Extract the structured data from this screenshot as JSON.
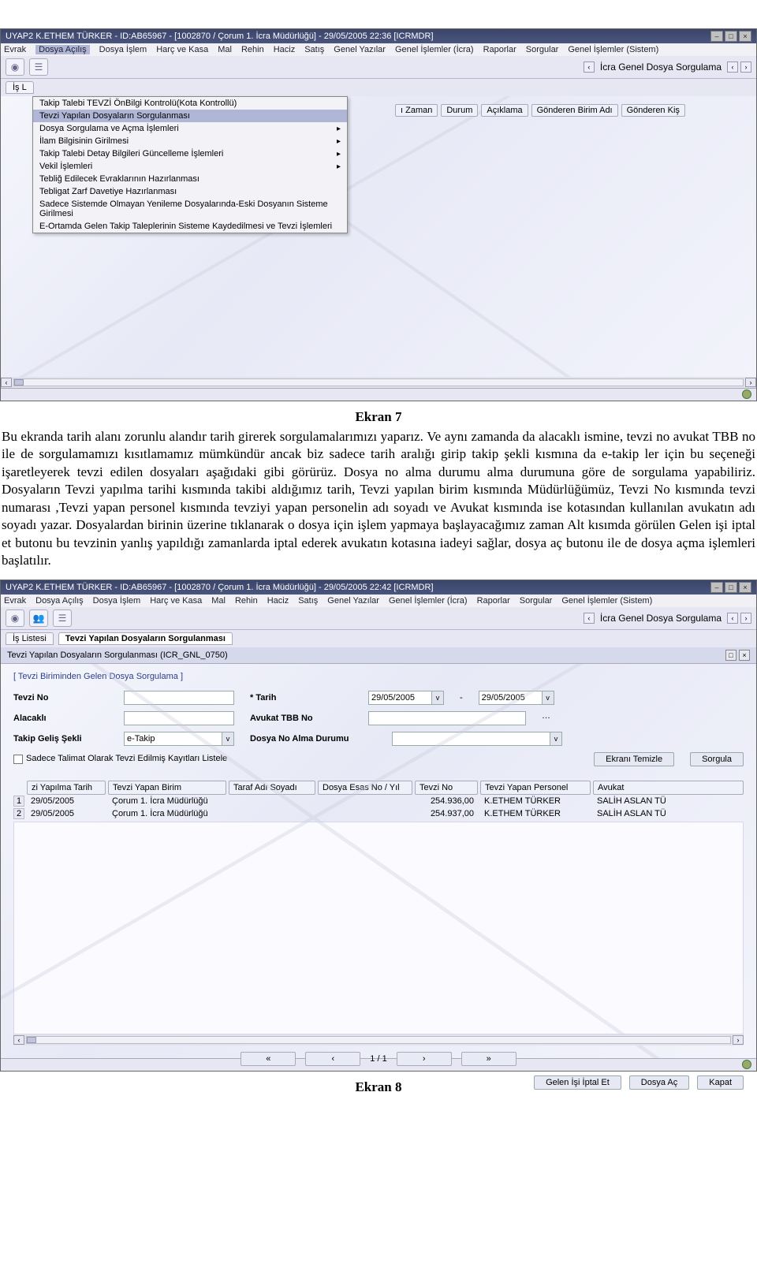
{
  "screenshot1": {
    "title": "UYAP2  K.ETHEM TÜRKER - ID:AB65967 - [1002870 / Çorum 1. İcra Müdürlüğü] - 29/05/2005 22:36 [ICRMDR]",
    "menubar": [
      "Evrak",
      "Dosya Açılış",
      "Dosya İşlem",
      "Harç ve Kasa",
      "Mal",
      "Rehin",
      "Haciz",
      "Satış",
      "Genel Yazılar",
      "Genel İşlemler (İcra)",
      "Raporlar",
      "Sorgular",
      "Genel İşlemler (Sistem)"
    ],
    "menu_active_index": 1,
    "breadcrumb_right": "İcra Genel Dosya Sorgulama",
    "tab_left": "İş L",
    "dropdown": [
      "Takip Talebi TEVZİ ÖnBilgi Kontrolü(Kota Kontrollü)",
      "Tevzi Yapılan Dosyaların Sorgulanması",
      "Dosya Sorgulama ve Açma İşlemleri",
      "İlam Bilgisinin Girilmesi",
      "Takip Talebi Detay Bilgileri Güncelleme İşlemleri",
      "Vekil İşlemleri",
      "Tebliğ Edilecek Evraklarının Hazırlanması",
      "Tebligat Zarf Davetiye Hazırlanması",
      "Sadece Sistemde Olmayan Yenileme Dosyalarında-Eski Dosyanın Sisteme Girilmesi",
      "E-Ortamda Gelen Takip Taleplerinin Sisteme Kaydedilmesi ve Tevzi İşlemleri"
    ],
    "dropdown_hl_index": 1,
    "dropdown_arrow_indices": [
      2,
      3,
      4,
      5
    ],
    "column_headers_partial": [
      "ı Zaman",
      "Durum",
      "Açıklama",
      "Gönderen Birim Adı",
      "Gönderen Kiş"
    ]
  },
  "caption1": "Ekran 7",
  "paragraph1": "Bu ekranda tarih alanı zorunlu alandır tarih girerek sorgulamalarımızı yaparız. Ve aynı zamanda da alacaklı ismine, tevzi no avukat TBB no ile de sorgulamamızı kısıtlamamız mümkündür ancak biz sadece tarih aralığı girip takip şekli kısmına da e-takip ler için bu seçeneği işaretleyerek tevzi edilen dosyaları aşağıdaki gibi görürüz. Dosya no alma durumu alma durumuna göre de sorgulama yapabiliriz. Dosyaların Tevzi yapılma tarihi kısmında takibi aldığımız tarih, Tevzi yapılan birim kısmında Müdürlüğümüz, Tevzi No kısmında tevzi numarası ,Tevzi yapan personel kısmında tevziyi yapan personelin adı soyadı ve Avukat kısmında ise kotasından kullanılan avukatın adı soyadı yazar. Dosyalardan birinin üzerine tıklanarak o dosya için işlem yapmaya başlayacağımız zaman Alt kısımda görülen Gelen işi iptal et butonu bu tevzinin yanlış yapıldığı zamanlarda iptal ederek avukatın kotasına iadeyi sağlar, dosya aç butonu ile de dosya açma işlemleri başlatılır.",
  "screenshot2": {
    "title": "UYAP2  K.ETHEM TÜRKER - ID:AB65967 - [1002870 / Çorum 1. İcra Müdürlüğü] - 29/05/2005 22:42 [ICRMDR]",
    "menubar": [
      "Evrak",
      "Dosya Açılış",
      "Dosya İşlem",
      "Harç ve Kasa",
      "Mal",
      "Rehin",
      "Haciz",
      "Satış",
      "Genel Yazılar",
      "Genel İşlemler (İcra)",
      "Raporlar",
      "Sorgular",
      "Genel İşlemler (Sistem)"
    ],
    "breadcrumb_right": "İcra Genel Dosya Sorgulama",
    "tab_left": "İş Listesi",
    "tab_active": "Tevzi Yapılan Dosyaların Sorgulanması",
    "panel_title": "Tevzi Yapılan Dosyaların Sorgulanması (ICR_GNL_0750)",
    "form_title": "[ Tevzi Biriminden Gelen Dosya Sorgulama ]",
    "labels": {
      "tevzi_no": "Tevzi No",
      "tarih": "* Tarih",
      "alacakli": "Alacaklı",
      "avukat_tbb": "Avukat TBB No",
      "takip_gelis": "Takip Geliş Şekli",
      "dosya_no_alma": "Dosya No Alma Durumu",
      "checkbox": "Sadece Talimat Olarak Tevzi Edilmiş Kayıtları Listele",
      "btn_clear": "Ekranı Temizle",
      "btn_query": "Sorgula"
    },
    "values": {
      "tarih_from": "29/05/2005",
      "tarih_to": "29/05/2005",
      "tarih_sep": "-",
      "takip_gelis": "e-Takip"
    },
    "table_headers": [
      "zi Yapılma Tarih",
      "Tevzi Yapan Birim",
      "Taraf Adı Soyadı",
      "Dosya Esas No / Yıl",
      "Tevzi No",
      "Tevzi Yapan Personel",
      "Avukat"
    ],
    "rows": [
      {
        "n": "1",
        "d": "29/05/2005",
        "b": "Çorum 1. İcra Müdürlüğü",
        "t": "",
        "e": "",
        "no": "254.936,00",
        "p": "K.ETHEM TÜRKER",
        "a": "SALİH ASLAN TÜ"
      },
      {
        "n": "2",
        "d": "29/05/2005",
        "b": "Çorum 1. İcra Müdürlüğü",
        "t": "",
        "e": "",
        "no": "254.937,00",
        "p": "K.ETHEM TÜRKER",
        "a": "SALİH ASLAN TÜ"
      }
    ],
    "pager": {
      "first": "«",
      "prev": "‹",
      "cur": "1",
      "sep": "/ 1",
      "next": "›",
      "last": "»"
    },
    "buttons": {
      "cancel": "Gelen İşi İptal Et",
      "open": "Dosya Aç",
      "close": "Kapat"
    }
  },
  "caption2": "Ekran 8"
}
